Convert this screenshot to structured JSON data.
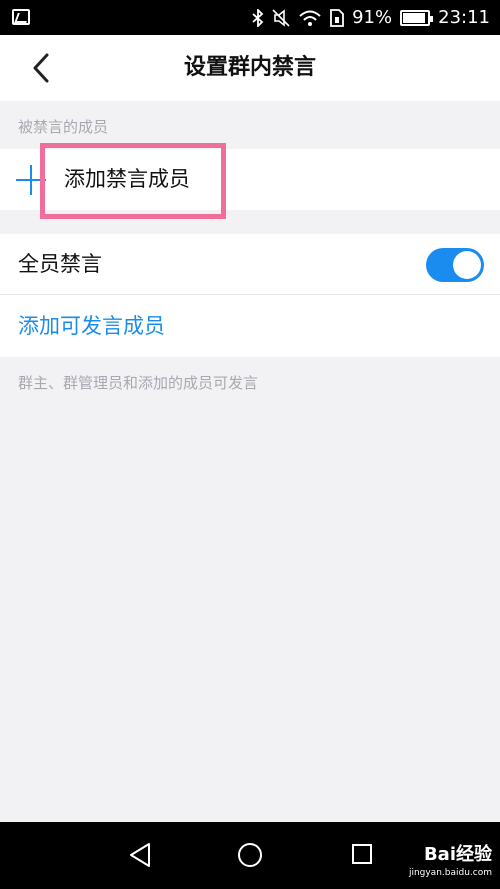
{
  "status_bar": {
    "battery_percent": "91%",
    "battery_level": 0.91,
    "time": "23:11"
  },
  "nav": {
    "title": "设置群内禁言"
  },
  "muted_section": {
    "header": "被禁言的成员",
    "add_label": "添加禁言成员"
  },
  "mute_all": {
    "label": "全员禁言",
    "enabled": true
  },
  "speakers": {
    "add_label": "添加可发言成员",
    "footnote": "群主、群管理员和添加的成员可发言"
  },
  "watermark": {
    "brand": "Bai经验",
    "site": "jingyan.baidu.com"
  },
  "colors": {
    "accent": "#1a8cf0",
    "highlight": "#ef6f9a"
  }
}
